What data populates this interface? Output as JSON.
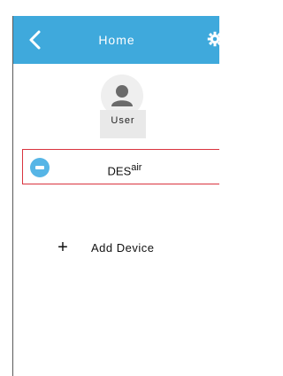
{
  "header": {
    "title": "Home",
    "background_color": "#3fa9dc",
    "back_icon": "chevron-left-icon",
    "settings_icon": "gear-icon"
  },
  "user": {
    "label": "User",
    "avatar_icon": "person-icon"
  },
  "devices": [
    {
      "name": "DES",
      "name_superscript": "air",
      "icon": "air-conditioner-icon",
      "selected_border_color": "#d9343f"
    }
  ],
  "add_device": {
    "icon": "plus-icon",
    "label": "Add Device"
  }
}
